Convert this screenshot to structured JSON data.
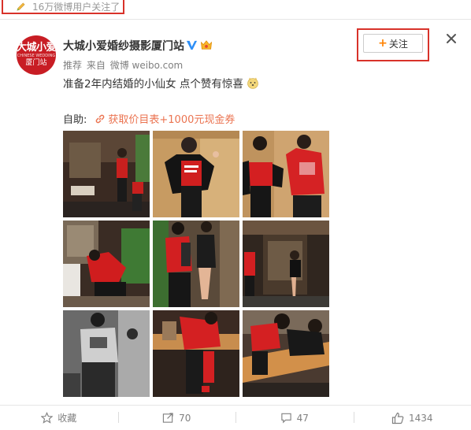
{
  "top_notice": {
    "text": "16万微博用户关注了"
  },
  "profile": {
    "logo_main": "大城小爱",
    "logo_sub": "CHINESE WEDDING",
    "logo_city": "厦门站",
    "name": "大城小爱婚纱摄影厦门站",
    "meta": {
      "tag": "推荐",
      "from": "来自",
      "source": "微博 weibo.com"
    }
  },
  "post": {
    "text": "准备2年内结婚的小仙女  点个赞有惊喜",
    "auto_label": "自助:",
    "link_text": "获取价目表+1000元现金券"
  },
  "follow_button": {
    "plus": "+",
    "label": "关注"
  },
  "actions": {
    "favorite": "收藏",
    "repost": "70",
    "comment": "47",
    "like": "1434"
  },
  "colors": {
    "accent_red": "#d8322a",
    "link_orange": "#eb7350",
    "brand_red": "#c81d24",
    "verify_blue": "#2e8ff6"
  },
  "icons": {
    "top_notice": "pen-icon",
    "verify": "verified-v-icon",
    "vip": "vip-badge-icon",
    "link": "link-icon",
    "close": "close-icon",
    "favorite": "star-icon",
    "repost": "repost-icon",
    "comment": "comment-icon",
    "like": "thumbs-up-icon"
  }
}
